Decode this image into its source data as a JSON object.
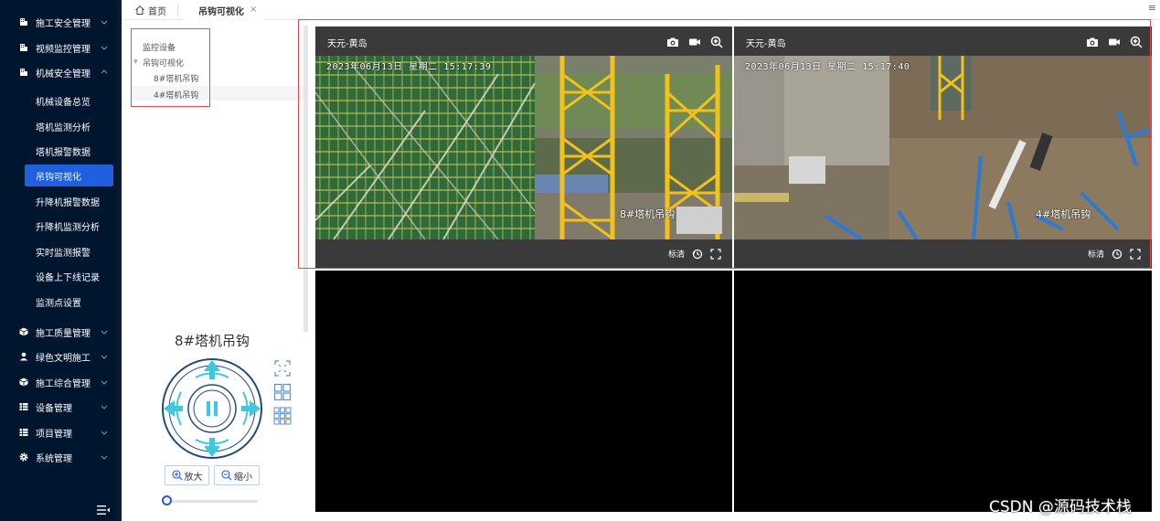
{
  "sidebar": {
    "menu": [
      {
        "label": "施工安全管理",
        "icon": "building-icon",
        "expanded": false
      },
      {
        "label": "视频监控管理",
        "icon": "building-icon",
        "expanded": false
      },
      {
        "label": "机械安全管理",
        "icon": "building-icon",
        "expanded": true
      },
      {
        "label": "施工质量管理",
        "icon": "cube-icon",
        "expanded": false
      },
      {
        "label": "绿色文明施工",
        "icon": "person-icon",
        "expanded": false
      },
      {
        "label": "施工综合管理",
        "icon": "cube-icon",
        "expanded": false
      },
      {
        "label": "设备管理",
        "icon": "list-icon",
        "expanded": false
      },
      {
        "label": "项目管理",
        "icon": "list-icon",
        "expanded": false
      },
      {
        "label": "系统管理",
        "icon": "gear-icon",
        "expanded": false
      }
    ],
    "submenu": [
      {
        "label": "机械设备总览",
        "active": false
      },
      {
        "label": "塔机监测分析",
        "active": false
      },
      {
        "label": "塔机报警数据",
        "active": false
      },
      {
        "label": "吊钩可视化",
        "active": true
      },
      {
        "label": "升降机报警数据",
        "active": false
      },
      {
        "label": "升降机监测分析",
        "active": false
      },
      {
        "label": "实时监测报警",
        "active": false
      },
      {
        "label": "设备上下线记录",
        "active": false
      },
      {
        "label": "监测点设置",
        "active": false
      }
    ]
  },
  "tabs": {
    "home": "首页",
    "active": "吊钩可视化",
    "close": "×",
    "menu": "≡"
  },
  "tree": {
    "root": "监控设备",
    "group": "吊钩可视化",
    "devices": [
      "8#塔机吊钩",
      "4#塔机吊钩"
    ]
  },
  "ptz": {
    "device_title": "8#塔机吊钩",
    "zoom_in": "放大",
    "zoom_out": "缩小",
    "slider_value": 0
  },
  "videos": [
    {
      "title": "天元-黄岛",
      "timestamp": "2023年06月13日  星期二 15:17:39",
      "osd": "8#塔机吊钩",
      "quality": "标清"
    },
    {
      "title": "天元-黄岛",
      "timestamp": "2023年06月13日  星期二 15:17:40",
      "osd": "4#塔机吊钩",
      "quality": "标清"
    }
  ],
  "watermark": "CSDN @源码技术栈",
  "colors": {
    "sidebar_bg": "#00152e",
    "active_blue": "#1f5fe0",
    "accent_cyan": "#3ec8e0",
    "outline_red": "#e84b4b",
    "video_bar": "#3a3a3a"
  }
}
